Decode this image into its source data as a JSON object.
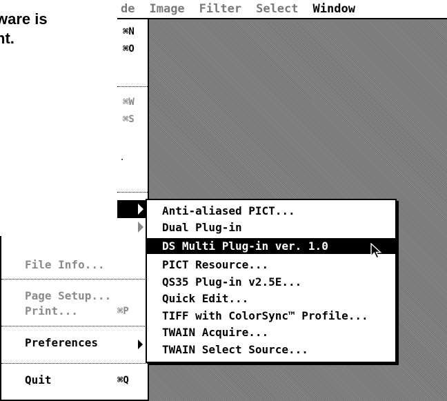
{
  "caption": {
    "line1": "ware is",
    "line2": "nt."
  },
  "menubar": {
    "items": [
      {
        "label": "de",
        "active": false
      },
      {
        "label": "Image",
        "active": false
      },
      {
        "label": "Filter",
        "active": false
      },
      {
        "label": "Select",
        "active": false
      },
      {
        "label": "Window",
        "active": true
      }
    ]
  },
  "file_menu_top": {
    "shortcuts": [
      "⌘N",
      "⌘O",
      "⌘W",
      "⌘S"
    ]
  },
  "file_menu_bottom": {
    "file_info": "File Info...",
    "page_setup": "Page Setup...",
    "print": "Print...",
    "print_shortcut": "⌘P",
    "preferences": "Preferences",
    "quit": "Quit",
    "quit_shortcut": "⌘Q"
  },
  "submenu": {
    "items": [
      "Anti-aliased PICT...",
      "Dual Plug-in",
      "DS Multi Plug-in ver. 1.0",
      "PICT Resource...",
      "QS35 Plug-in v2.5E...",
      "Quick Edit...",
      "TIFF with ColorSync™ Profile...",
      "TWAIN Acquire...",
      "TWAIN Select Source..."
    ],
    "selected_index": 2
  }
}
